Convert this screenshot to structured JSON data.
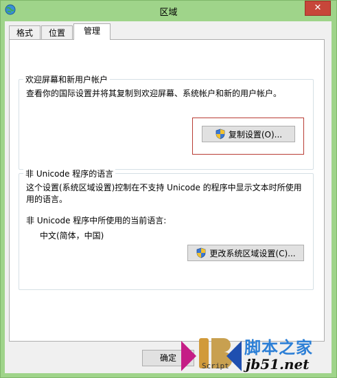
{
  "window": {
    "title": "区域",
    "close_glyph": "✕"
  },
  "tabs": [
    {
      "label": "格式",
      "active": false
    },
    {
      "label": "位置",
      "active": false
    },
    {
      "label": "管理",
      "active": true
    }
  ],
  "welcome_group": {
    "title": "欢迎屏幕和新用户帐户",
    "description": "查看你的国际设置并将其复制到欢迎屏幕、系统帐户和新的用户帐户。",
    "copy_button": "复制设置(O)..."
  },
  "non_unicode_group": {
    "title": "非 Unicode 程序的语言",
    "description_line1": "这个设置(系统区域设置)控制在不支持 Unicode 的程序中显示文本时所使用",
    "description_line2": "用的语言。",
    "current_label": "非 Unicode 程序中所使用的当前语言:",
    "current_value": "中文(简体，中国)",
    "change_button": "更改系统区域设置(C)..."
  },
  "footer": {
    "ok_label": "确定"
  },
  "watermark": {
    "script_text": "Script",
    "site_name": "脚本之家",
    "url": "jb51.net"
  },
  "colors": {
    "window_frame": "#9fd48a",
    "highlight": "#b83b33",
    "close": "#c7463a"
  },
  "icons": {
    "app": "globe-icon",
    "button": "uac-shield-icon"
  }
}
